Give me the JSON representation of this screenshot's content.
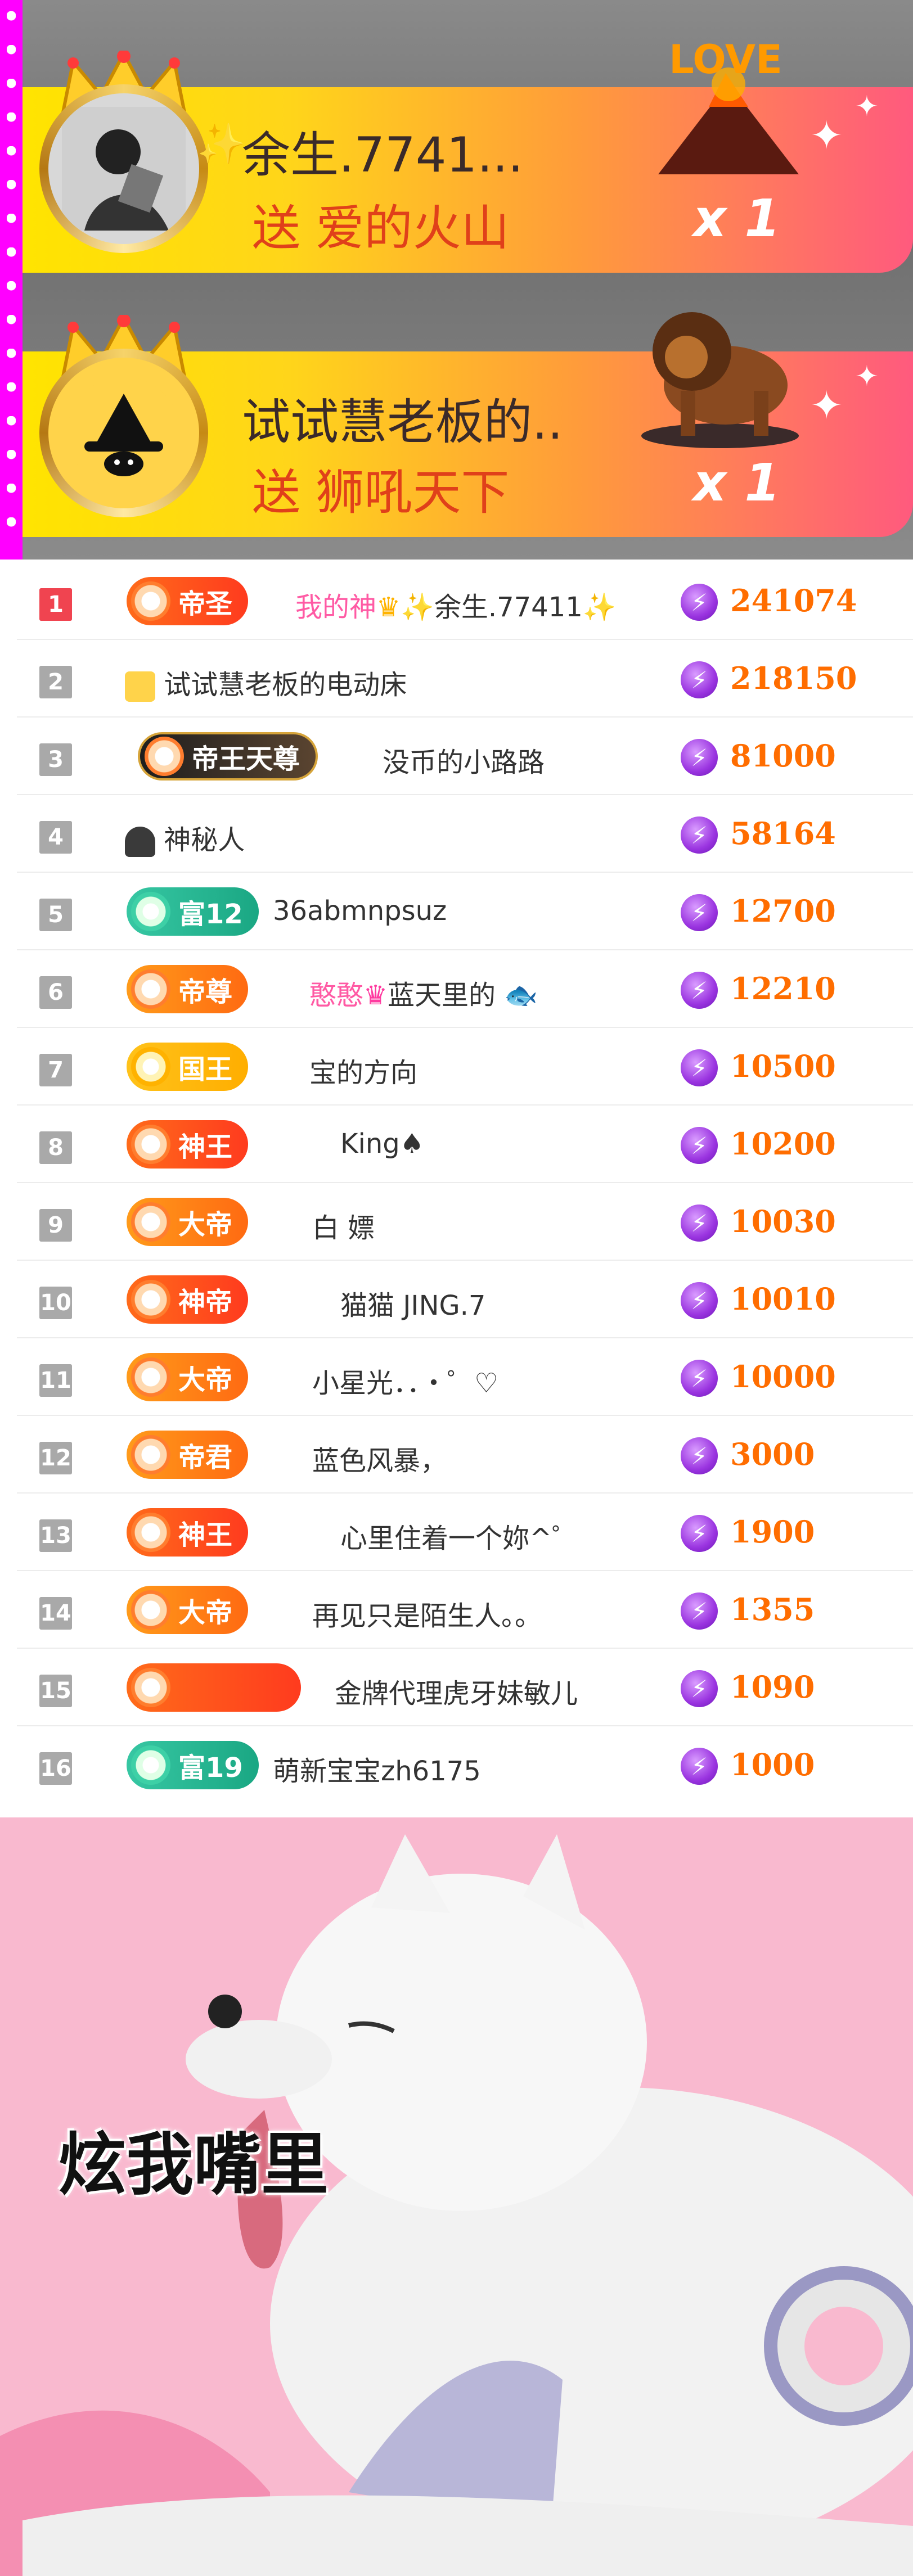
{
  "gifts": [
    {
      "user": "余生.7741...",
      "action": "送",
      "gift_name": "爱的火山",
      "count": "x 1",
      "gift_image_text": "LOVE"
    },
    {
      "user": "试试慧老板的..",
      "action": "送",
      "gift_name": "狮吼天下",
      "count": "x 1"
    }
  ],
  "ranking": [
    {
      "rank": "1",
      "badge": "帝圣",
      "name_prefix": "我的神",
      "name": "余生.77411",
      "score": "241074"
    },
    {
      "rank": "2",
      "badge": "",
      "name": "试试慧老板的电动床",
      "score": "218150"
    },
    {
      "rank": "3",
      "badge": "帝王天尊",
      "name": "没币的小路路",
      "score": "81000"
    },
    {
      "rank": "4",
      "badge": "",
      "name": "神秘人",
      "score": "58164"
    },
    {
      "rank": "5",
      "badge": "富12",
      "name": "36abmnpsuz",
      "score": "12700"
    },
    {
      "rank": "6",
      "badge": "帝尊",
      "name_prefix": "憨憨",
      "name": "蓝天里的",
      "score": "12210"
    },
    {
      "rank": "7",
      "badge": "国王",
      "name": "宝的方向",
      "score": "10500"
    },
    {
      "rank": "8",
      "badge": "神王",
      "name": "King♠",
      "score": "10200"
    },
    {
      "rank": "9",
      "badge": "大帝",
      "name": "白  嫖",
      "score": "10030"
    },
    {
      "rank": "10",
      "badge": "神帝",
      "name": "猫猫  JING.7",
      "score": "10010"
    },
    {
      "rank": "11",
      "badge": "大帝",
      "name": "小星光．．・゜♡",
      "score": "10000"
    },
    {
      "rank": "12",
      "badge": "帝君",
      "name": "蓝色风暴，",
      "score": "3000"
    },
    {
      "rank": "13",
      "badge": "神王",
      "name": "心里住着一个妳^゜",
      "score": "1900"
    },
    {
      "rank": "14",
      "badge": "大帝",
      "name": "再见只是陌生人。。",
      "score": "1355"
    },
    {
      "rank": "15",
      "badge": "",
      "name": "金牌代理虎牙妹敏儿",
      "score": "1090"
    },
    {
      "rank": "16",
      "badge": "富19",
      "name": "萌新宝宝zh6175",
      "score": "1000"
    }
  ],
  "meme": {
    "caption": "炫我嘴里"
  },
  "colors": {
    "score": "#ff6d00",
    "rank_top": "#f04450",
    "gift_text": "#e0401a",
    "page_bg": "#f9b9cf"
  }
}
